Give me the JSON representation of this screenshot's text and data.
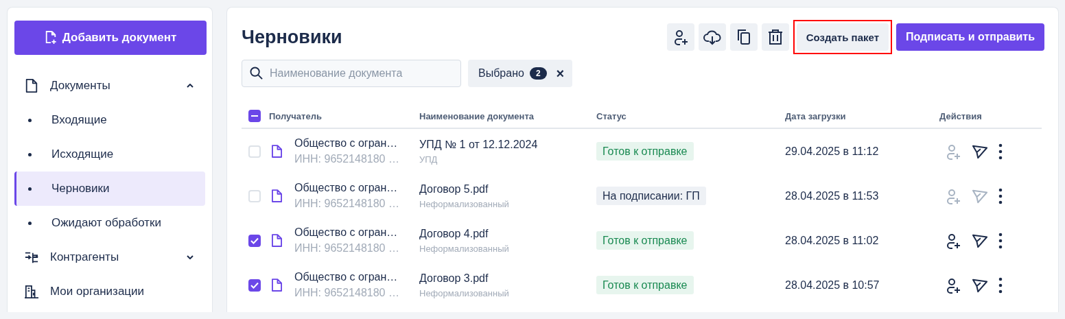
{
  "sidebar": {
    "add_button": "Добавить документ",
    "items": [
      {
        "label": "Документы",
        "expanded": true,
        "children": [
          {
            "label": "Входящие",
            "selected": false
          },
          {
            "label": "Исходящие",
            "selected": false
          },
          {
            "label": "Черновики",
            "selected": true
          },
          {
            "label": "Ожидают обработки",
            "selected": false
          }
        ]
      },
      {
        "label": "Контрагенты",
        "expanded": false
      },
      {
        "label": "Мои организации"
      }
    ]
  },
  "main": {
    "title": "Черновики",
    "toolbar": {
      "create_package": {
        "label": "Создать пакет",
        "highlighted": true
      },
      "sign_send": "Подписать и отправить"
    },
    "search": {
      "placeholder": "Наименование документа"
    },
    "selected_chip": {
      "label": "Выбрано",
      "count": "2",
      "close": "×"
    },
    "table": {
      "select_all": {
        "indeterminate": true
      },
      "columns": [
        "Получатель",
        "Наименование документа",
        "Статус",
        "Дата загрузки",
        "Действия"
      ],
      "rows": [
        {
          "checked": false,
          "recipient": "Общество с огран…",
          "inn": "ИНН: 9652148180 …",
          "doc": "УПД № 1 от 12.12.2024",
          "doc_type": "УПД",
          "status": {
            "label": "Готов к отправке",
            "kind": "ready"
          },
          "date": "29.04.2025 в 11:12",
          "assign_disabled": true,
          "send_disabled": false
        },
        {
          "checked": false,
          "recipient": "Общество с огран…",
          "inn": "ИНН: 9652148180 …",
          "doc": "Договор 5.pdf",
          "doc_type": "Неформализованный",
          "status": {
            "label": "На подписании: ГП",
            "kind": "signing"
          },
          "date": "28.04.2025 в 11:53",
          "assign_disabled": true,
          "send_disabled": true
        },
        {
          "checked": true,
          "recipient": "Общество с огран…",
          "inn": "ИНН: 9652148180 …",
          "doc": "Договор 4.pdf",
          "doc_type": "Неформализованный",
          "status": {
            "label": "Готов к отправке",
            "kind": "ready"
          },
          "date": "28.04.2025 в 11:02",
          "assign_disabled": false,
          "send_disabled": false
        },
        {
          "checked": true,
          "recipient": "Общество с огран…",
          "inn": "ИНН: 9652148180 …",
          "doc": "Договор 3.pdf",
          "doc_type": "Неформализованный",
          "status": {
            "label": "Готов к отправке",
            "kind": "ready"
          },
          "date": "28.04.2025 в 10:57",
          "assign_disabled": false,
          "send_disabled": false
        }
      ]
    }
  }
}
